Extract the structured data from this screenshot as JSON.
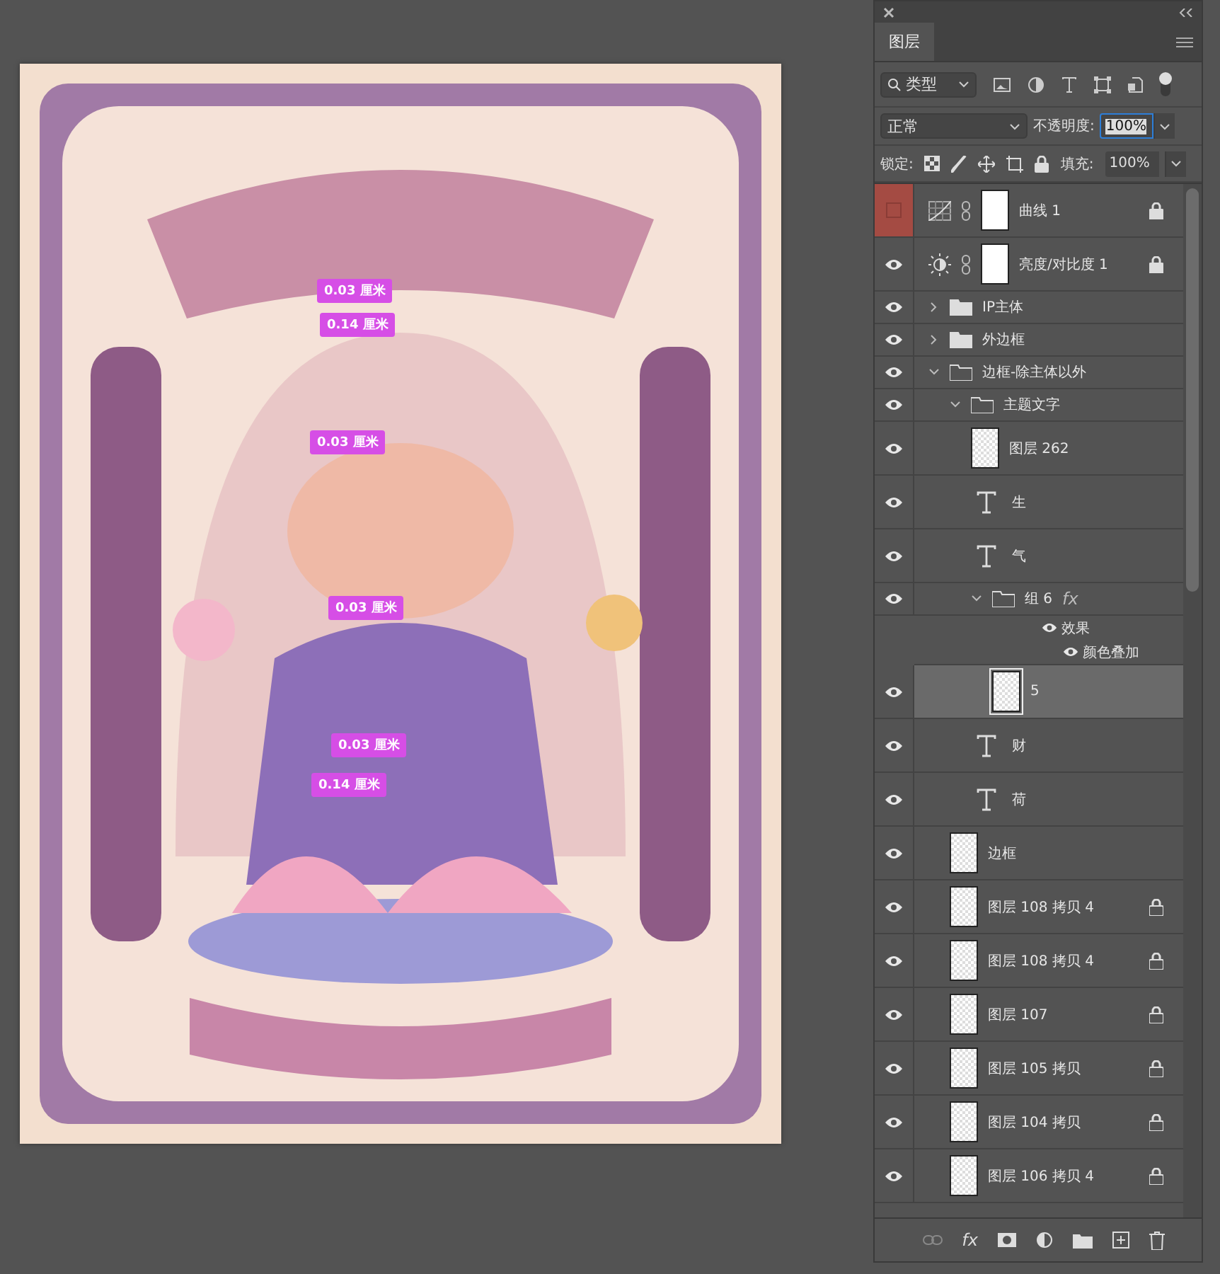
{
  "canvas": {
    "kind": "picture",
    "measure_labels": [
      "0.03 厘米",
      "0.14 厘米",
      "0.03 厘米",
      "0.03 厘米",
      "0.03 厘米",
      "0.14 厘米"
    ]
  },
  "layers_panel": {
    "tab": {
      "label": "图层",
      "selected": true
    },
    "filter": {
      "label": "类型"
    },
    "blend_mode": "正常",
    "opacity_label": "不透明度:",
    "opacity": "100%",
    "lock_label": "锁定:",
    "fill_label": "填充:",
    "fill": "100%",
    "style_button": "fx",
    "layers": [
      {
        "kind": "curves",
        "name": "曲线 1",
        "visible": false,
        "locked": true,
        "selected": false
      },
      {
        "kind": "brightness",
        "name": "亮度/对比度 1",
        "visible": true,
        "locked": true,
        "selected": false
      },
      {
        "kind": "folder",
        "name": "IP主体",
        "visible": true,
        "expanded": false,
        "selected": false
      },
      {
        "kind": "folder",
        "name": "外边框",
        "visible": true,
        "expanded": false,
        "selected": false
      },
      {
        "kind": "folder",
        "name": "边框-除主体以外",
        "visible": true,
        "expanded": true,
        "selected": false,
        "children": [
          {
            "kind": "folder",
            "name": "主题文字",
            "visible": true,
            "expanded": true,
            "selected": false,
            "children": [
              {
                "kind": "pixel",
                "name": "图层 262",
                "visible": true,
                "locked": false,
                "selected": false
              },
              {
                "kind": "text",
                "name": "生",
                "visible": true,
                "selected": false
              },
              {
                "kind": "text",
                "name": "气",
                "visible": true,
                "selected": false
              },
              {
                "kind": "folder",
                "name": "组 6",
                "visible": true,
                "expanded": true,
                "selected": false,
                "fx": "fx",
                "effects": {
                  "label": "效果",
                  "items": [
                    "颜色叠加"
                  ]
                },
                "children": [
                  {
                    "kind": "pixel",
                    "name": "5",
                    "visible": true,
                    "locked": false,
                    "selected": true
                  }
                ]
              },
              {
                "kind": "text",
                "name": "财",
                "visible": true,
                "selected": false
              },
              {
                "kind": "text",
                "name": "荷",
                "visible": true,
                "selected": false
              }
            ]
          },
          {
            "kind": "pixel",
            "name": "边框",
            "visible": true,
            "locked": false,
            "selected": false
          },
          {
            "kind": "pixel",
            "name": "图层 108 拷贝 4",
            "visible": true,
            "locked": true,
            "selected": false
          },
          {
            "kind": "pixel",
            "name": "图层 108 拷贝 4",
            "visible": true,
            "locked": true,
            "selected": false
          },
          {
            "kind": "pixel",
            "name": "图层 107",
            "visible": true,
            "locked": true,
            "selected": false
          },
          {
            "kind": "pixel",
            "name": "图层 105 拷贝",
            "visible": true,
            "locked": true,
            "selected": false
          },
          {
            "kind": "pixel",
            "name": "图层 104 拷贝",
            "visible": true,
            "locked": true,
            "selected": false
          },
          {
            "kind": "pixel",
            "name": "图层 106 拷贝 4",
            "visible": true,
            "locked": true,
            "selected": false
          }
        ]
      }
    ]
  }
}
